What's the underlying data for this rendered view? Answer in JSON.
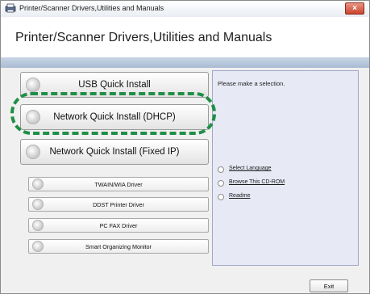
{
  "window": {
    "title": "Printer/Scanner Drivers,Utilities and Manuals",
    "close_glyph": "×"
  },
  "header": {
    "title": "Printer/Scanner Drivers,Utilities and Manuals"
  },
  "install_buttons": [
    {
      "label": "USB Quick Install"
    },
    {
      "label": "Network Quick Install (DHCP)"
    },
    {
      "label": "Network Quick Install (Fixed IP)"
    }
  ],
  "driver_buttons": [
    {
      "label": "TWAIN/WIA Driver"
    },
    {
      "label": "DDST Printer Driver"
    },
    {
      "label": "PC FAX Driver"
    },
    {
      "label": "Smart Organizing Monitor"
    }
  ],
  "info_panel": {
    "message": "Please make a selection.",
    "links": [
      {
        "label": "Select Language"
      },
      {
        "label": "Browse This CD-ROM"
      },
      {
        "label": "Readme"
      }
    ]
  },
  "footer": {
    "exit_label": "Exit"
  },
  "colors": {
    "highlight": "#1f8f45",
    "band": "#b8c7dc",
    "info_panel_bg": "#e7e9f5"
  }
}
